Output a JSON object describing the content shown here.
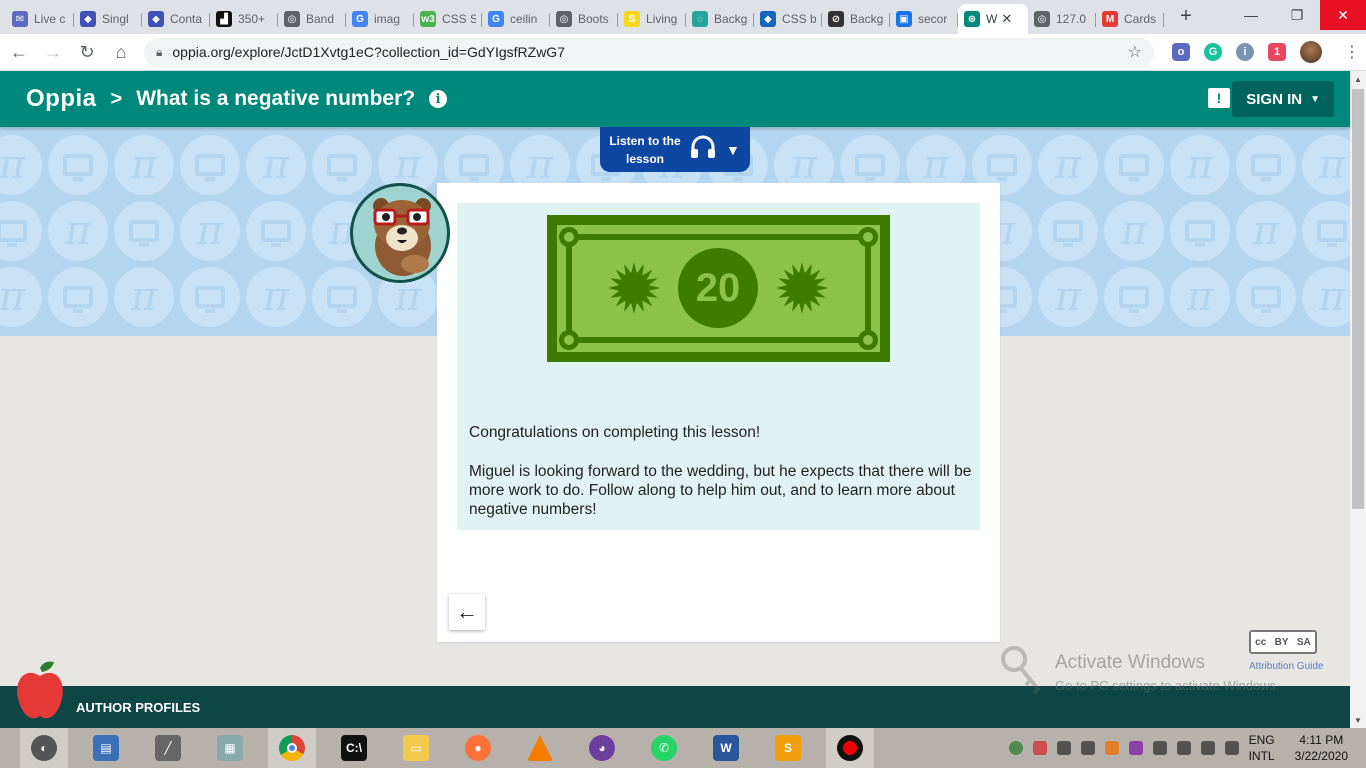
{
  "browser": {
    "tabs": [
      {
        "label": "Live c",
        "color": "#5c6bc0",
        "glyph": "✉"
      },
      {
        "label": "Singl",
        "color": "#3f51b5",
        "glyph": "◆"
      },
      {
        "label": "Conta",
        "color": "#3f51b5",
        "glyph": "◆"
      },
      {
        "label": "350+",
        "color": "#111111",
        "glyph": "▟"
      },
      {
        "label": "Band",
        "color": "#5f6368",
        "glyph": "◎"
      },
      {
        "label": "imag",
        "color": "#4285f4",
        "glyph": "G"
      },
      {
        "label": "CSS S",
        "color": "#4caf50",
        "glyph": "w3"
      },
      {
        "label": "ceilin",
        "color": "#4285f4",
        "glyph": "G"
      },
      {
        "label": "Boots",
        "color": "#5f6368",
        "glyph": "◎"
      },
      {
        "label": "Living",
        "color": "#f9d71c",
        "glyph": "S"
      },
      {
        "label": "Backg",
        "color": "#26a69a",
        "glyph": "◌"
      },
      {
        "label": "CSS b",
        "color": "#1565c0",
        "glyph": "◆"
      },
      {
        "label": "Backg",
        "color": "#333333",
        "glyph": "⊘"
      },
      {
        "label": "secor",
        "color": "#1a73e8",
        "glyph": "▣"
      }
    ],
    "active_tab": {
      "label": "W",
      "color": "#00897b",
      "glyph": "⊛",
      "close": "✕"
    },
    "tabs_after": [
      {
        "label": "127.0",
        "color": "#5f6368",
        "glyph": "◎"
      },
      {
        "label": "Cards",
        "color": "#e53935",
        "glyph": "M"
      }
    ],
    "new_tab": "+",
    "url": "oppia.org/explore/JctD1Xvtg1eC?collection_id=GdYIgsfRZwG7",
    "window_controls": {
      "minimize": "—",
      "maximize": "❐",
      "close": "✕"
    }
  },
  "header": {
    "logo": "Oppia",
    "separator": ">",
    "lesson_title": "What is a negative number?",
    "info": "i",
    "feedback": "!",
    "signin_label": "SIGN IN",
    "signin_caret": "▼"
  },
  "audio": {
    "label_line1": "Listen to the",
    "label_line2": "lesson",
    "caret": "▼"
  },
  "card": {
    "bill_value": "20",
    "paragraphs": [
      "Congratulations on completing this lesson!",
      "Miguel is looking forward to the wedding, but he expects that there will be more work to do. Follow along to help him out, and to learn more about negative numbers!"
    ],
    "back_arrow": "←"
  },
  "footer": {
    "link": "AUTHOR PROFILES",
    "license_badge": "cc",
    "license_by": "BY",
    "license_sa": "SA",
    "attribution": "Attribution Guide"
  },
  "watermark": {
    "line1": "Activate Windows",
    "line2": "Go to PC settings to activate Windows."
  },
  "taskbar": {
    "lang_line1": "ENG",
    "lang_line2": "INTL",
    "time": "4:11 PM",
    "date": "3/22/2020"
  }
}
